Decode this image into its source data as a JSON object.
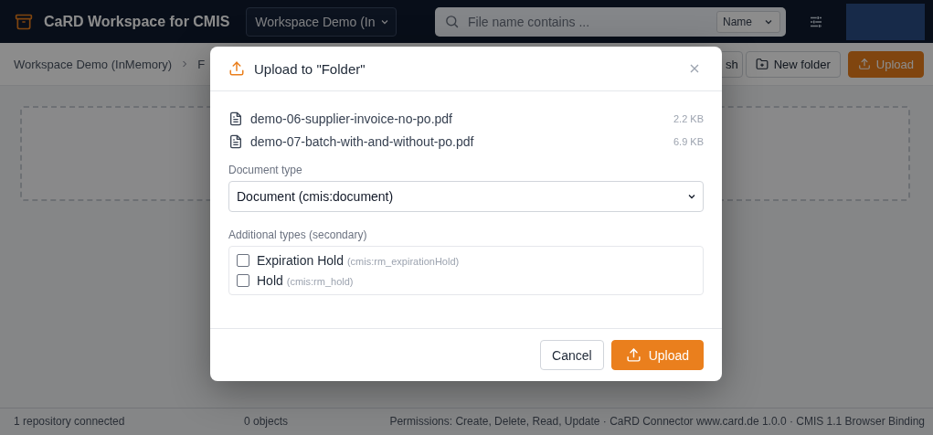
{
  "header": {
    "title": "CaRD Workspace for CMIS",
    "repository_select": "Workspace Demo (In",
    "search": {
      "placeholder": "File name contains ...",
      "field_select": "Name"
    }
  },
  "toolbar": {
    "breadcrumb": [
      "Workspace Demo (InMemory)",
      "F"
    ],
    "buttons": [
      {
        "label": "sh",
        "kind": "plain"
      },
      {
        "label": "New folder",
        "kind": "folder"
      },
      {
        "label": "Upload",
        "kind": "primary"
      }
    ]
  },
  "dialog": {
    "title": "Upload to \"Folder\"",
    "files": [
      {
        "name": "demo-06-supplier-invoice-no-po.pdf",
        "size": "2.2 KB"
      },
      {
        "name": "demo-07-batch-with-and-without-po.pdf",
        "size": "6.9 KB"
      }
    ],
    "document_type": {
      "label": "Document type",
      "value": "Document (cmis:document)"
    },
    "secondary": {
      "label": "Additional types (secondary)",
      "items": [
        {
          "name": "Expiration Hold",
          "type_id": "(cmis:rm_expirationHold)",
          "checked": false
        },
        {
          "name": "Hold",
          "type_id": "(cmis:rm_hold)",
          "checked": false
        }
      ]
    },
    "buttons": [
      {
        "label": "Cancel",
        "kind": "secondary"
      },
      {
        "label": "Upload",
        "kind": "primary"
      }
    ]
  },
  "status_bar": [
    "1 repository connected",
    "0 objects",
    "Permissions: Create, Delete, Read, Update · CaRD Connector www.card.de 1.0.0 · CMIS 1.1 Browser Binding"
  ]
}
